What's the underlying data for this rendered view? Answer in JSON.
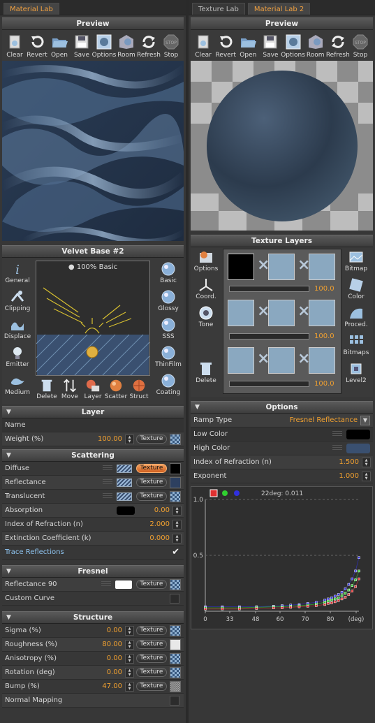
{
  "left": {
    "tab": "Material Lab",
    "preview_title": "Preview",
    "toolbar": [
      "Clear",
      "Revert",
      "Open",
      "Save",
      "Options",
      "Room",
      "Refresh",
      "Stop"
    ],
    "velvet": {
      "title": "Velvet Base #2",
      "basic_label": "100% Basic",
      "left_icons": [
        "General",
        "Clipping",
        "Displace",
        "Emitter",
        "Medium"
      ],
      "right_icons": [
        "Basic",
        "Glossy",
        "SSS",
        "ThinFilm",
        "Coating"
      ],
      "bottom_icons": [
        "Delete",
        "Move",
        "Layer",
        "Scatter",
        "Struct"
      ]
    },
    "layer": {
      "title": "Layer",
      "name_label": "Name",
      "weight_label": "Weight (%)",
      "weight_value": "100.00",
      "texture": "Texture"
    },
    "scattering": {
      "title": "Scattering",
      "diffuse": "Diffuse",
      "reflectance": "Reflectance",
      "translucent": "Translucent",
      "absorption": "Absorption",
      "absorption_value": "0.00",
      "ior": "Index of Refraction (n)",
      "ior_value": "2.000",
      "ext": "Extinction Coefficient (k)",
      "ext_value": "0.000",
      "trace": "Trace Reflections",
      "texture": "Texture"
    },
    "fresnel": {
      "title": "Fresnel",
      "reflectance90": "Reflectance 90",
      "custom": "Custom Curve",
      "texture": "Texture"
    },
    "structure": {
      "title": "Structure",
      "rows": [
        {
          "label": "Sigma (%)",
          "value": "0.00"
        },
        {
          "label": "Roughness (%)",
          "value": "80.00"
        },
        {
          "label": "Anisotropy (%)",
          "value": "0.00"
        },
        {
          "label": "Rotation (deg)",
          "value": "0.00"
        },
        {
          "label": "Bump (%)",
          "value": "47.00"
        }
      ],
      "normal": "Normal Mapping",
      "texture": "Texture"
    }
  },
  "right": {
    "tabs": [
      "Texture Lab",
      "Material Lab 2"
    ],
    "preview_title": "Preview",
    "toolbar": [
      "Clear",
      "Revert",
      "Open",
      "Save",
      "Options",
      "Room",
      "Refresh",
      "Stop"
    ],
    "texture_layers": {
      "title": "Texture Layers",
      "left_icons": [
        "Options",
        "Coord.",
        "Tone",
        "Delete"
      ],
      "right_icons": [
        "Bitmap",
        "Color",
        "Proced.",
        "Bitmaps",
        "Level2"
      ],
      "values": [
        "100.0",
        "100.0",
        "100.0"
      ]
    },
    "options": {
      "title": "Options",
      "ramp_label": "Ramp Type",
      "ramp_value": "Fresnel Reflectance",
      "low": "Low Color",
      "high": "High Color",
      "ior": "Index of Refraction (n)",
      "ior_value": "1.500",
      "exp": "Exponent",
      "exp_value": "1.000"
    }
  },
  "chart_data": {
    "type": "scatter",
    "annotation": "22deg: 0.011",
    "y_ticks": [
      "1.0",
      "0.5"
    ],
    "x_ticks": [
      "0",
      "33",
      "48",
      "60",
      "70",
      "80",
      "(deg)"
    ],
    "ylim": [
      0,
      1
    ],
    "series": [
      {
        "color": "#3030e0",
        "x": [
          0,
          10,
          20,
          30,
          40,
          45,
          50,
          55,
          60,
          65,
          70,
          72,
          74,
          76,
          78,
          80,
          82,
          84,
          86,
          88,
          90
        ],
        "y": [
          0.04,
          0.04,
          0.04,
          0.04,
          0.045,
          0.05,
          0.055,
          0.06,
          0.07,
          0.08,
          0.1,
          0.11,
          0.12,
          0.135,
          0.15,
          0.17,
          0.2,
          0.24,
          0.29,
          0.36,
          0.48
        ]
      },
      {
        "color": "#30d030",
        "x": [
          0,
          10,
          20,
          30,
          40,
          45,
          50,
          55,
          60,
          65,
          70,
          72,
          74,
          76,
          78,
          80,
          82,
          84,
          86,
          88,
          90
        ],
        "y": [
          0.03,
          0.03,
          0.03,
          0.035,
          0.04,
          0.04,
          0.045,
          0.05,
          0.055,
          0.065,
          0.08,
          0.09,
          0.1,
          0.11,
          0.12,
          0.14,
          0.16,
          0.19,
          0.23,
          0.28,
          0.36
        ]
      },
      {
        "color": "#e03030",
        "x": [
          0,
          10,
          20,
          30,
          40,
          45,
          50,
          55,
          60,
          65,
          70,
          72,
          74,
          76,
          78,
          80,
          82,
          84,
          86,
          88,
          90
        ],
        "y": [
          0.02,
          0.02,
          0.02,
          0.025,
          0.03,
          0.03,
          0.035,
          0.04,
          0.045,
          0.05,
          0.06,
          0.07,
          0.075,
          0.085,
          0.095,
          0.11,
          0.125,
          0.15,
          0.18,
          0.22,
          0.29
        ]
      }
    ]
  }
}
